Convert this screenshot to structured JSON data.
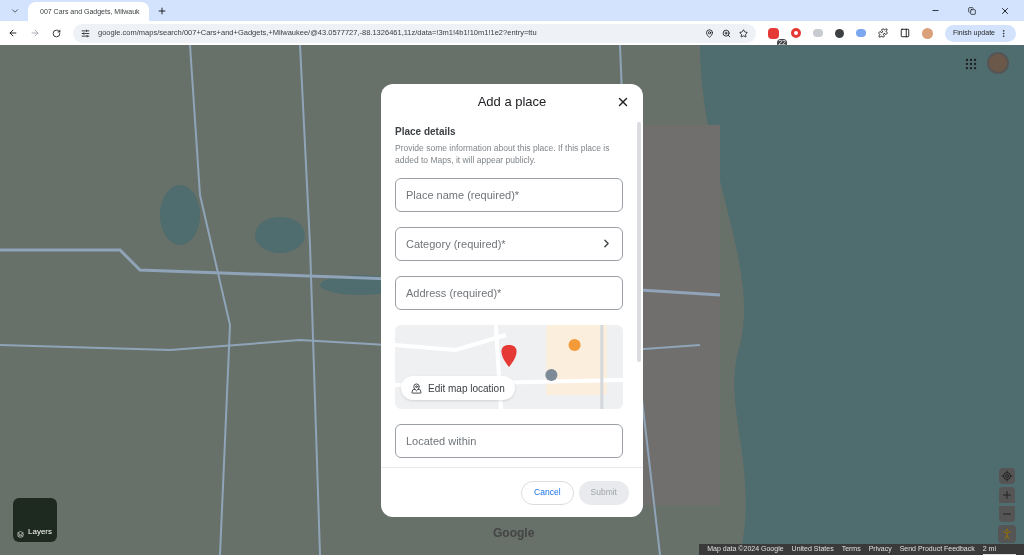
{
  "browser": {
    "tab": {
      "title": "007 Cars and Gadgets, Milwauk",
      "selected": true
    },
    "url": "google.com/maps/search/007+Cars+and+Gadgets,+Milwaukee/@43.0577727,-88.1326461,11z/data=!3m1!4b1!10m1!1e2?entry=ttu",
    "extension_badge": "22",
    "update_button": "Finish update"
  },
  "map": {
    "kind": "picture",
    "layers_button": "Layers",
    "logo": "Google",
    "footer": [
      "Map data ©2024 Google",
      "United States",
      "Terms",
      "Privacy",
      "Send Product Feedback"
    ],
    "scale": "2 mi"
  },
  "dialog": {
    "title": "Add a place",
    "section_title": "Place details",
    "description": "Provide some information about this place. If this place is added to Maps, it will appear publicly.",
    "fields": [
      {
        "kind": "text",
        "placeholder": "Place name (required)*"
      },
      {
        "kind": "select",
        "placeholder": "Category (required)*"
      },
      {
        "kind": "text",
        "placeholder": "Address (required)*"
      },
      {
        "kind": "map",
        "button": "Edit map location"
      },
      {
        "kind": "text",
        "placeholder": "Located within"
      }
    ],
    "buttons": [
      {
        "label": "Cancel",
        "disabled": false
      },
      {
        "label": "Submit",
        "disabled": true
      }
    ]
  }
}
